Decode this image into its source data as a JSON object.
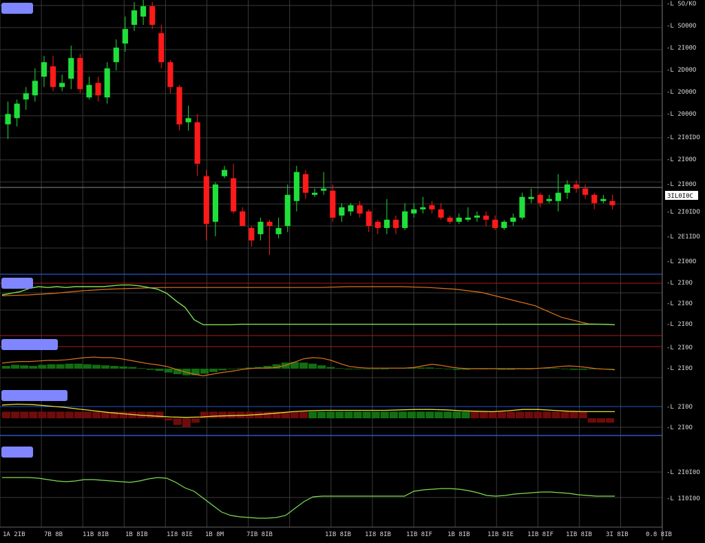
{
  "colors": {
    "background": "#000000",
    "grid": "#3a3a3a",
    "bull": "#1fe03a",
    "bear": "#ff1a1a",
    "pane_label": "#7f86ff",
    "axis_text": "#d8d8d8",
    "line_green": "#7fe050",
    "line_orange": "#e0741c",
    "line_yellow": "#e8e030",
    "line_red": "#b01818",
    "line_blue": "#2a55c8",
    "hist_red": "#6e0c0c",
    "hist_green": "#126e12"
  },
  "panes": {
    "main_label": "",
    "indicator1_label": "",
    "indicator2_label": "",
    "indicator3_label": "",
    "indicator4_label": ""
  },
  "price_axis": {
    "tick_labels": [
      "-L SO/KO",
      "-L SO00O",
      "-L 2I00O",
      "-L 2D00O",
      "-L 2O00O",
      "-L 2000O",
      "-L 2I0IDO",
      "-L 2I00O",
      "-L 2I00O",
      "-L 2I0IDO",
      "-L 2E1IDO",
      "-L 2I00O"
    ],
    "current_price_label": "3IL0I0C"
  },
  "indicator_axis_labels": {
    "ind1": [
      "-L 2I0O",
      "-L 2I0O",
      "-L 2I0O"
    ],
    "ind2": [
      "-L 2I0O",
      "-L 2I0O"
    ],
    "ind3": [
      "-L 2I0O",
      "-L 2I0O"
    ],
    "ind4": [
      "-L 2I0I0O",
      "-L 1I0I0O"
    ]
  },
  "time_axis": {
    "labels": [
      "1A 2IB",
      "7B 8B",
      "11B 8IB",
      "1B 8IB",
      "1I8 8IE",
      "1B 8M",
      "7IB 8IB",
      "1IB 8IB",
      "1I8 8IB",
      "1IB 8IF",
      "1B 8IB",
      "1IB 8IE",
      "1IB 8IF",
      "1IB 8IB",
      "3I 8IB",
      "0.8 8IB"
    ]
  },
  "chart_data": {
    "type": "candlestick",
    "y_range_data": [
      0,
      11
    ],
    "price_ticks": [
      10.5,
      9.5,
      8.5,
      7.5,
      6.5,
      5.5,
      4.5,
      3.5,
      2.5,
      1.5,
      0.5,
      -0.5
    ],
    "candles": [
      {
        "o": 5.3,
        "c": 5.8,
        "h": 6.4,
        "l": 4.6
      },
      {
        "o": 5.6,
        "c": 6.3,
        "h": 6.5,
        "l": 5.2
      },
      {
        "o": 6.5,
        "c": 6.8,
        "h": 7.1,
        "l": 6.0
      },
      {
        "o": 6.7,
        "c": 7.4,
        "h": 8.0,
        "l": 6.4
      },
      {
        "o": 7.6,
        "c": 8.3,
        "h": 8.6,
        "l": 7.1
      },
      {
        "o": 8.1,
        "c": 7.1,
        "h": 8.6,
        "l": 6.9
      },
      {
        "o": 7.1,
        "c": 7.3,
        "h": 7.7,
        "l": 6.9
      },
      {
        "o": 7.5,
        "c": 8.5,
        "h": 9.1,
        "l": 7.0
      },
      {
        "o": 8.5,
        "c": 7.0,
        "h": 8.7,
        "l": 6.8
      },
      {
        "o": 6.6,
        "c": 7.2,
        "h": 7.6,
        "l": 6.5
      },
      {
        "o": 7.3,
        "c": 6.7,
        "h": 7.6,
        "l": 6.4
      },
      {
        "o": 6.6,
        "c": 8.0,
        "h": 8.3,
        "l": 6.3
      },
      {
        "o": 8.3,
        "c": 9.0,
        "h": 9.4,
        "l": 7.9
      },
      {
        "o": 9.2,
        "c": 9.9,
        "h": 10.5,
        "l": 8.8
      },
      {
        "o": 10.1,
        "c": 10.8,
        "h": 11.2,
        "l": 9.8
      },
      {
        "o": 10.5,
        "c": 11.0,
        "h": 11.3,
        "l": 10.1
      },
      {
        "o": 11.0,
        "c": 10.1,
        "h": 11.2,
        "l": 9.9
      },
      {
        "o": 9.7,
        "c": 8.3,
        "h": 10.1,
        "l": 8.0
      },
      {
        "o": 8.3,
        "c": 7.1,
        "h": 8.4,
        "l": 6.8
      },
      {
        "o": 7.1,
        "c": 5.3,
        "h": 7.2,
        "l": 5.0
      },
      {
        "o": 5.4,
        "c": 5.6,
        "h": 6.2,
        "l": 5.0
      },
      {
        "o": 5.4,
        "c": 3.4,
        "h": 5.8,
        "l": 2.8
      },
      {
        "o": 2.8,
        "c": 0.5,
        "h": 3.1,
        "l": -0.3
      },
      {
        "o": 0.6,
        "c": 2.4,
        "h": 2.5,
        "l": -0.1
      },
      {
        "o": 2.8,
        "c": 3.1,
        "h": 3.3,
        "l": 2.7
      },
      {
        "o": 2.7,
        "c": 1.1,
        "h": 3.4,
        "l": 1.0
      },
      {
        "o": 1.1,
        "c": 0.4,
        "h": 1.3,
        "l": 0.4
      },
      {
        "o": 0.3,
        "c": -0.3,
        "h": 0.4,
        "l": -0.6
      },
      {
        "o": 0.0,
        "c": 0.6,
        "h": 0.8,
        "l": -0.3
      },
      {
        "o": 0.6,
        "c": 0.4,
        "h": 0.7,
        "l": -1.0
      },
      {
        "o": 0.0,
        "c": 0.3,
        "h": 0.8,
        "l": -0.2
      },
      {
        "o": 0.4,
        "c": 1.9,
        "h": 2.4,
        "l": 0.1
      },
      {
        "o": 1.6,
        "c": 3.0,
        "h": 3.3,
        "l": 1.1
      },
      {
        "o": 2.9,
        "c": 2.0,
        "h": 3.1,
        "l": 1.7
      },
      {
        "o": 1.9,
        "c": 2.0,
        "h": 2.2,
        "l": 1.8
      },
      {
        "o": 2.1,
        "c": 2.2,
        "h": 3.0,
        "l": 1.9
      },
      {
        "o": 2.1,
        "c": 0.8,
        "h": 2.4,
        "l": 0.6
      },
      {
        "o": 0.9,
        "c": 1.3,
        "h": 1.5,
        "l": 0.6
      },
      {
        "o": 1.1,
        "c": 1.4,
        "h": 1.5,
        "l": 0.9
      },
      {
        "o": 1.4,
        "c": 1.0,
        "h": 1.6,
        "l": 0.8
      },
      {
        "o": 1.1,
        "c": 0.4,
        "h": 1.2,
        "l": 0.1
      },
      {
        "o": 0.6,
        "c": 0.3,
        "h": 0.7,
        "l": 0.0
      },
      {
        "o": 0.3,
        "c": 0.7,
        "h": 1.7,
        "l": 0.0
      },
      {
        "o": 0.7,
        "c": 0.3,
        "h": 0.9,
        "l": 0.0
      },
      {
        "o": 0.3,
        "c": 1.1,
        "h": 1.5,
        "l": 0.2
      },
      {
        "o": 1.0,
        "c": 1.2,
        "h": 1.5,
        "l": 0.8
      },
      {
        "o": 1.2,
        "c": 1.3,
        "h": 1.8,
        "l": 1.0
      },
      {
        "o": 1.4,
        "c": 1.2,
        "h": 1.6,
        "l": 1.0
      },
      {
        "o": 1.2,
        "c": 0.8,
        "h": 1.5,
        "l": 0.7
      },
      {
        "o": 0.8,
        "c": 0.6,
        "h": 0.9,
        "l": 0.5
      },
      {
        "o": 0.6,
        "c": 0.8,
        "h": 1.0,
        "l": 0.5
      },
      {
        "o": 0.7,
        "c": 0.8,
        "h": 1.3,
        "l": 0.6
      },
      {
        "o": 0.8,
        "c": 0.9,
        "h": 1.1,
        "l": 0.6
      },
      {
        "o": 0.9,
        "c": 0.7,
        "h": 1.1,
        "l": 0.4
      },
      {
        "o": 0.7,
        "c": 0.3,
        "h": 0.9,
        "l": 0.2
      },
      {
        "o": 0.3,
        "c": 0.6,
        "h": 0.7,
        "l": 0.2
      },
      {
        "o": 0.6,
        "c": 0.8,
        "h": 1.0,
        "l": 0.4
      },
      {
        "o": 0.8,
        "c": 1.8,
        "h": 2.0,
        "l": 0.7
      },
      {
        "o": 1.7,
        "c": 1.8,
        "h": 2.2,
        "l": 1.5
      },
      {
        "o": 1.9,
        "c": 1.5,
        "h": 2.0,
        "l": 1.3
      },
      {
        "o": 1.6,
        "c": 1.7,
        "h": 1.9,
        "l": 1.5
      },
      {
        "o": 1.6,
        "c": 2.0,
        "h": 2.9,
        "l": 1.1
      },
      {
        "o": 2.0,
        "c": 2.4,
        "h": 2.6,
        "l": 1.7
      },
      {
        "o": 2.4,
        "c": 2.2,
        "h": 2.6,
        "l": 2.0
      },
      {
        "o": 2.2,
        "c": 1.9,
        "h": 2.4,
        "l": 1.7
      },
      {
        "o": 1.9,
        "c": 1.5,
        "h": 2.0,
        "l": 1.2
      },
      {
        "o": 1.6,
        "c": 1.7,
        "h": 1.9,
        "l": 1.5
      },
      {
        "o": 1.6,
        "c": 1.4,
        "h": 1.9,
        "l": 1.2
      }
    ],
    "indicator1": {
      "green_line": [
        0.7,
        0.74,
        0.78,
        0.86,
        0.9,
        0.88,
        0.9,
        0.88,
        0.9,
        0.9,
        0.9,
        0.9,
        0.92,
        0.94,
        0.94,
        0.92,
        0.88,
        0.84,
        0.74,
        0.56,
        0.4,
        0.1,
        -0.02,
        -0.02,
        -0.02,
        -0.02,
        -0.01,
        -0.01,
        -0.01,
        -0.01,
        -0.01,
        -0.01,
        -0.01,
        -0.01,
        -0.01,
        -0.01,
        -0.01,
        -0.01,
        -0.01,
        -0.01,
        -0.01,
        -0.01,
        -0.01,
        -0.01,
        -0.01,
        -0.01,
        -0.01,
        -0.01,
        -0.01,
        -0.01,
        -0.01,
        -0.01,
        -0.01,
        -0.01,
        -0.01,
        -0.01,
        -0.01,
        -0.01,
        -0.01,
        -0.01,
        -0.01,
        -0.01,
        -0.01,
        -0.01,
        -0.01,
        -0.01,
        -0.01,
        -0.02
      ],
      "orange_line": [
        0.68,
        0.7,
        0.74,
        0.8,
        0.84,
        0.86,
        0.88,
        0.88,
        0.88,
        0.88,
        0.88,
        0.88,
        0.88,
        0.9,
        0.9,
        0.9,
        0.88,
        0.84,
        0.76,
        0.6,
        0.44,
        0.16,
        0.0,
        -0.02
      ]
    },
    "indicator2": {
      "orange_line": [
        0.2,
        0.24,
        0.26,
        0.26,
        0.28,
        0.3,
        0.3,
        0.32,
        0.36,
        0.4,
        0.42,
        0.4,
        0.4,
        0.36,
        0.3,
        0.24,
        0.18,
        0.14,
        0.08,
        -0.02,
        -0.12,
        -0.2,
        -0.26,
        -0.2,
        -0.14,
        -0.1,
        -0.04,
        0.0,
        0.02,
        0.02,
        0.04,
        0.12,
        0.24,
        0.36,
        0.4,
        0.38,
        0.3,
        0.18,
        0.08,
        0.04,
        0.02,
        0.02,
        0.02,
        0.02,
        0.02,
        0.04,
        0.1,
        0.16,
        0.12,
        0.06,
        0.02,
        0.0,
        0.0,
        0.0,
        0.0,
        0.0,
        0.0,
        0.0,
        0.0,
        0.02,
        0.04,
        0.08,
        0.1,
        0.08,
        0.04,
        0.0,
        -0.02,
        -0.04
      ],
      "hist": [
        0.1,
        0.14,
        0.12,
        0.1,
        0.14,
        0.16,
        0.16,
        0.18,
        0.18,
        0.16,
        0.14,
        0.12,
        0.1,
        0.08,
        0.06,
        0.02,
        -0.04,
        -0.08,
        -0.14,
        -0.2,
        -0.24,
        -0.24,
        -0.18,
        -0.12,
        -0.06,
        -0.02,
        0.02,
        0.04,
        0.06,
        0.1,
        0.16,
        0.22,
        0.24,
        0.22,
        0.18,
        0.12,
        0.06,
        0.02,
        0.0,
        -0.02,
        -0.02,
        -0.02,
        0.0,
        0.02,
        0.02,
        0.04,
        0.04,
        0.04,
        0.02,
        -0.02,
        -0.04,
        -0.04,
        -0.02,
        0.0,
        -0.02,
        -0.04,
        -0.04,
        -0.02,
        0.0,
        0.02,
        0.02,
        0.02,
        -0.02,
        -0.04,
        -0.04,
        -0.02,
        -0.02,
        -0.02
      ]
    },
    "indicator3": {
      "yellow_line": [
        0.6,
        0.64,
        0.62,
        0.56,
        0.5,
        0.42,
        0.34,
        0.26,
        0.2,
        0.14,
        0.1,
        0.06,
        0.04,
        0.06,
        0.1,
        0.12,
        0.14,
        0.18,
        0.24,
        0.3,
        0.34,
        0.36,
        0.36,
        0.36,
        0.36,
        0.36,
        0.38,
        0.4,
        0.4,
        0.38,
        0.34,
        0.32,
        0.3,
        0.34,
        0.4,
        0.4,
        0.36,
        0.32,
        0.3,
        0.3,
        0.3
      ],
      "hist": [
        0.3,
        0.3,
        0.3,
        0.3,
        0.3,
        0.3,
        0.3,
        0.3,
        0.3,
        0.3,
        0.3,
        0.3,
        0.3,
        0.3,
        0.3,
        0.3,
        0.3,
        0.3,
        -0.1,
        -0.3,
        -0.4,
        -0.2,
        0.3,
        0.3,
        0.3,
        0.3,
        0.3,
        0.3,
        0.3,
        0.3,
        0.3,
        0.3,
        0.3,
        0.3,
        0.3,
        0.3,
        0.3,
        0.3,
        0.3,
        0.3,
        0.3,
        0.3,
        0.3,
        0.3,
        0.3,
        0.3,
        0.3,
        0.3,
        0.3,
        0.3,
        0.3,
        0.3,
        0.3,
        0.3,
        0.3,
        0.3,
        0.3,
        0.3,
        0.3,
        0.3,
        0.3,
        0.3,
        0.3,
        0.3,
        0.3,
        -0.2,
        -0.2,
        -0.2
      ],
      "hist_colors": [
        "r",
        "r",
        "r",
        "r",
        "r",
        "r",
        "r",
        "r",
        "r",
        "r",
        "r",
        "r",
        "r",
        "r",
        "r",
        "r",
        "r",
        "r",
        "r",
        "r",
        "r",
        "r",
        "r",
        "r",
        "r",
        "r",
        "r",
        "r",
        "r",
        "r",
        "r",
        "r",
        "r",
        "r",
        "g",
        "g",
        "g",
        "g",
        "g",
        "g",
        "g",
        "g",
        "g",
        "g",
        "g",
        "g",
        "g",
        "g",
        "g",
        "g",
        "g",
        "g",
        "r",
        "r",
        "r",
        "r",
        "r",
        "r",
        "r",
        "r",
        "r",
        "r",
        "r",
        "r",
        "r",
        "r",
        "r",
        "r"
      ]
    },
    "indicator4": {
      "green_line": [
        0.5,
        0.5,
        0.5,
        0.5,
        0.48,
        0.44,
        0.4,
        0.38,
        0.4,
        0.44,
        0.44,
        0.42,
        0.4,
        0.38,
        0.36,
        0.4,
        0.46,
        0.5,
        0.48,
        0.36,
        0.2,
        0.1,
        -0.1,
        -0.3,
        -0.5,
        -0.6,
        -0.64,
        -0.66,
        -0.68,
        -0.68,
        -0.66,
        -0.6,
        -0.4,
        -0.2,
        -0.06,
        -0.04,
        -0.04,
        -0.04,
        -0.04,
        -0.04,
        -0.04,
        -0.04,
        -0.04,
        -0.04,
        -0.04,
        0.1,
        0.14,
        0.16,
        0.18,
        0.18,
        0.16,
        0.12,
        0.06,
        -0.02,
        -0.04,
        -0.02,
        0.02,
        0.04,
        0.06,
        0.08,
        0.08,
        0.06,
        0.04,
        0.0,
        -0.02,
        -0.04,
        -0.04,
        -0.04
      ]
    }
  }
}
